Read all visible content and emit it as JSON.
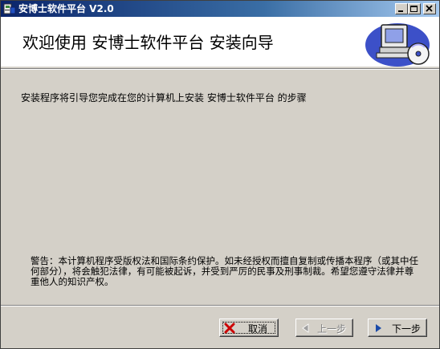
{
  "window": {
    "title": "安博士软件平台  V2.0"
  },
  "header": {
    "title": "欢迎使用  安博士软件平台  安装向导",
    "logo_icon": "computer-cd-icon"
  },
  "body": {
    "intro": "安装程序将引导您完成在您的计算机上安装  安博士软件平台  的步骤",
    "warning": "警告：本计算机程序受版权法和国际条约保护。如未经授权而擅自复制或传播本程序（或其中任何部分），将会触犯法律，有可能被起诉，并受到严厉的民事及刑事制裁。希望您遵守法律并尊重他人的知识产权。"
  },
  "buttons": {
    "cancel": "取消",
    "back": "上一步",
    "next": "下一步"
  },
  "colors": {
    "titlebar": "#0a246a",
    "face": "#d4d0c8",
    "cancel_icon": "#cc0000",
    "nav_arrow": "#1a4aa8"
  }
}
